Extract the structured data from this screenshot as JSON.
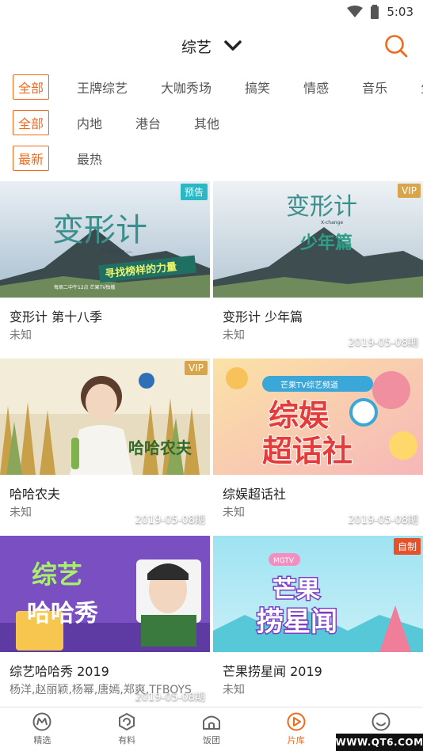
{
  "status_bar": {
    "time": "5:03",
    "wifi_icon": "wifi-icon",
    "battery_icon": "battery-icon"
  },
  "header": {
    "title": "综艺",
    "dropdown_icon": "chevron-down-icon",
    "search_icon": "search-icon",
    "accent_color": "#f06a1e"
  },
  "filters": {
    "genre": [
      "全部",
      "王牌综艺",
      "大咖秀场",
      "搞笑",
      "情感",
      "音乐",
      "生"
    ],
    "region": [
      "全部",
      "内地",
      "港台",
      "其他"
    ],
    "sort": [
      "最新",
      "最热"
    ]
  },
  "cards": [
    {
      "title": "变形计 第十八季",
      "subtitle": "未知",
      "badge": "预告",
      "badge_color": "#2bb8c6",
      "date": "",
      "art": {
        "main": "变形计",
        "sub": "— X-change —",
        "banner": "寻找榜样的力量",
        "footer": "每周二中午12点 芒果TV独播"
      }
    },
    {
      "title": "变形计 少年篇",
      "subtitle": "未知",
      "badge": "VIP",
      "badge_color": "#d9a54a",
      "date": "2019-05-08期",
      "art": {
        "main": "变形计",
        "sub": "X-change",
        "banner": "少年篇",
        "footer": ""
      }
    },
    {
      "title": "哈哈农夫",
      "subtitle": "未知",
      "badge": "VIP",
      "badge_color": "#d9a54a",
      "date": "2019-05-08期",
      "art": {
        "main": "哈哈农夫",
        "sub": "",
        "banner": "",
        "footer": ""
      }
    },
    {
      "title": "综娱超话社",
      "subtitle": "未知",
      "badge": "",
      "badge_color": "",
      "date": "2019-05-08期",
      "art": {
        "main": "综娱",
        "sub": "超话社",
        "banner": "芒果TV综艺频道",
        "footer": ""
      }
    },
    {
      "title": "综艺哈哈秀 2019",
      "subtitle": "杨洋,赵丽颖,杨幂,唐嫣,郑爽,TFBOYS",
      "badge": "",
      "badge_color": "",
      "date": "2019-05-08期",
      "art": {
        "main": "综艺",
        "sub": "哈哈秀",
        "banner": "",
        "footer": ""
      }
    },
    {
      "title": "芒果捞星闻 2019",
      "subtitle": "未知",
      "badge": "自制",
      "badge_color": "#e8502a",
      "date": "",
      "art": {
        "main": "芒果",
        "sub": "捞星闻",
        "banner": "MGTV",
        "footer": ""
      }
    }
  ],
  "bottom_nav": [
    {
      "label": "精选",
      "icon": "featured-icon"
    },
    {
      "label": "有料",
      "icon": "discover-icon"
    },
    {
      "label": "饭团",
      "icon": "fan-group-icon"
    },
    {
      "label": "片库",
      "icon": "library-play-icon"
    },
    {
      "label": "我的",
      "icon": "profile-icon"
    }
  ],
  "watermark": "WWW.QT6.COM"
}
